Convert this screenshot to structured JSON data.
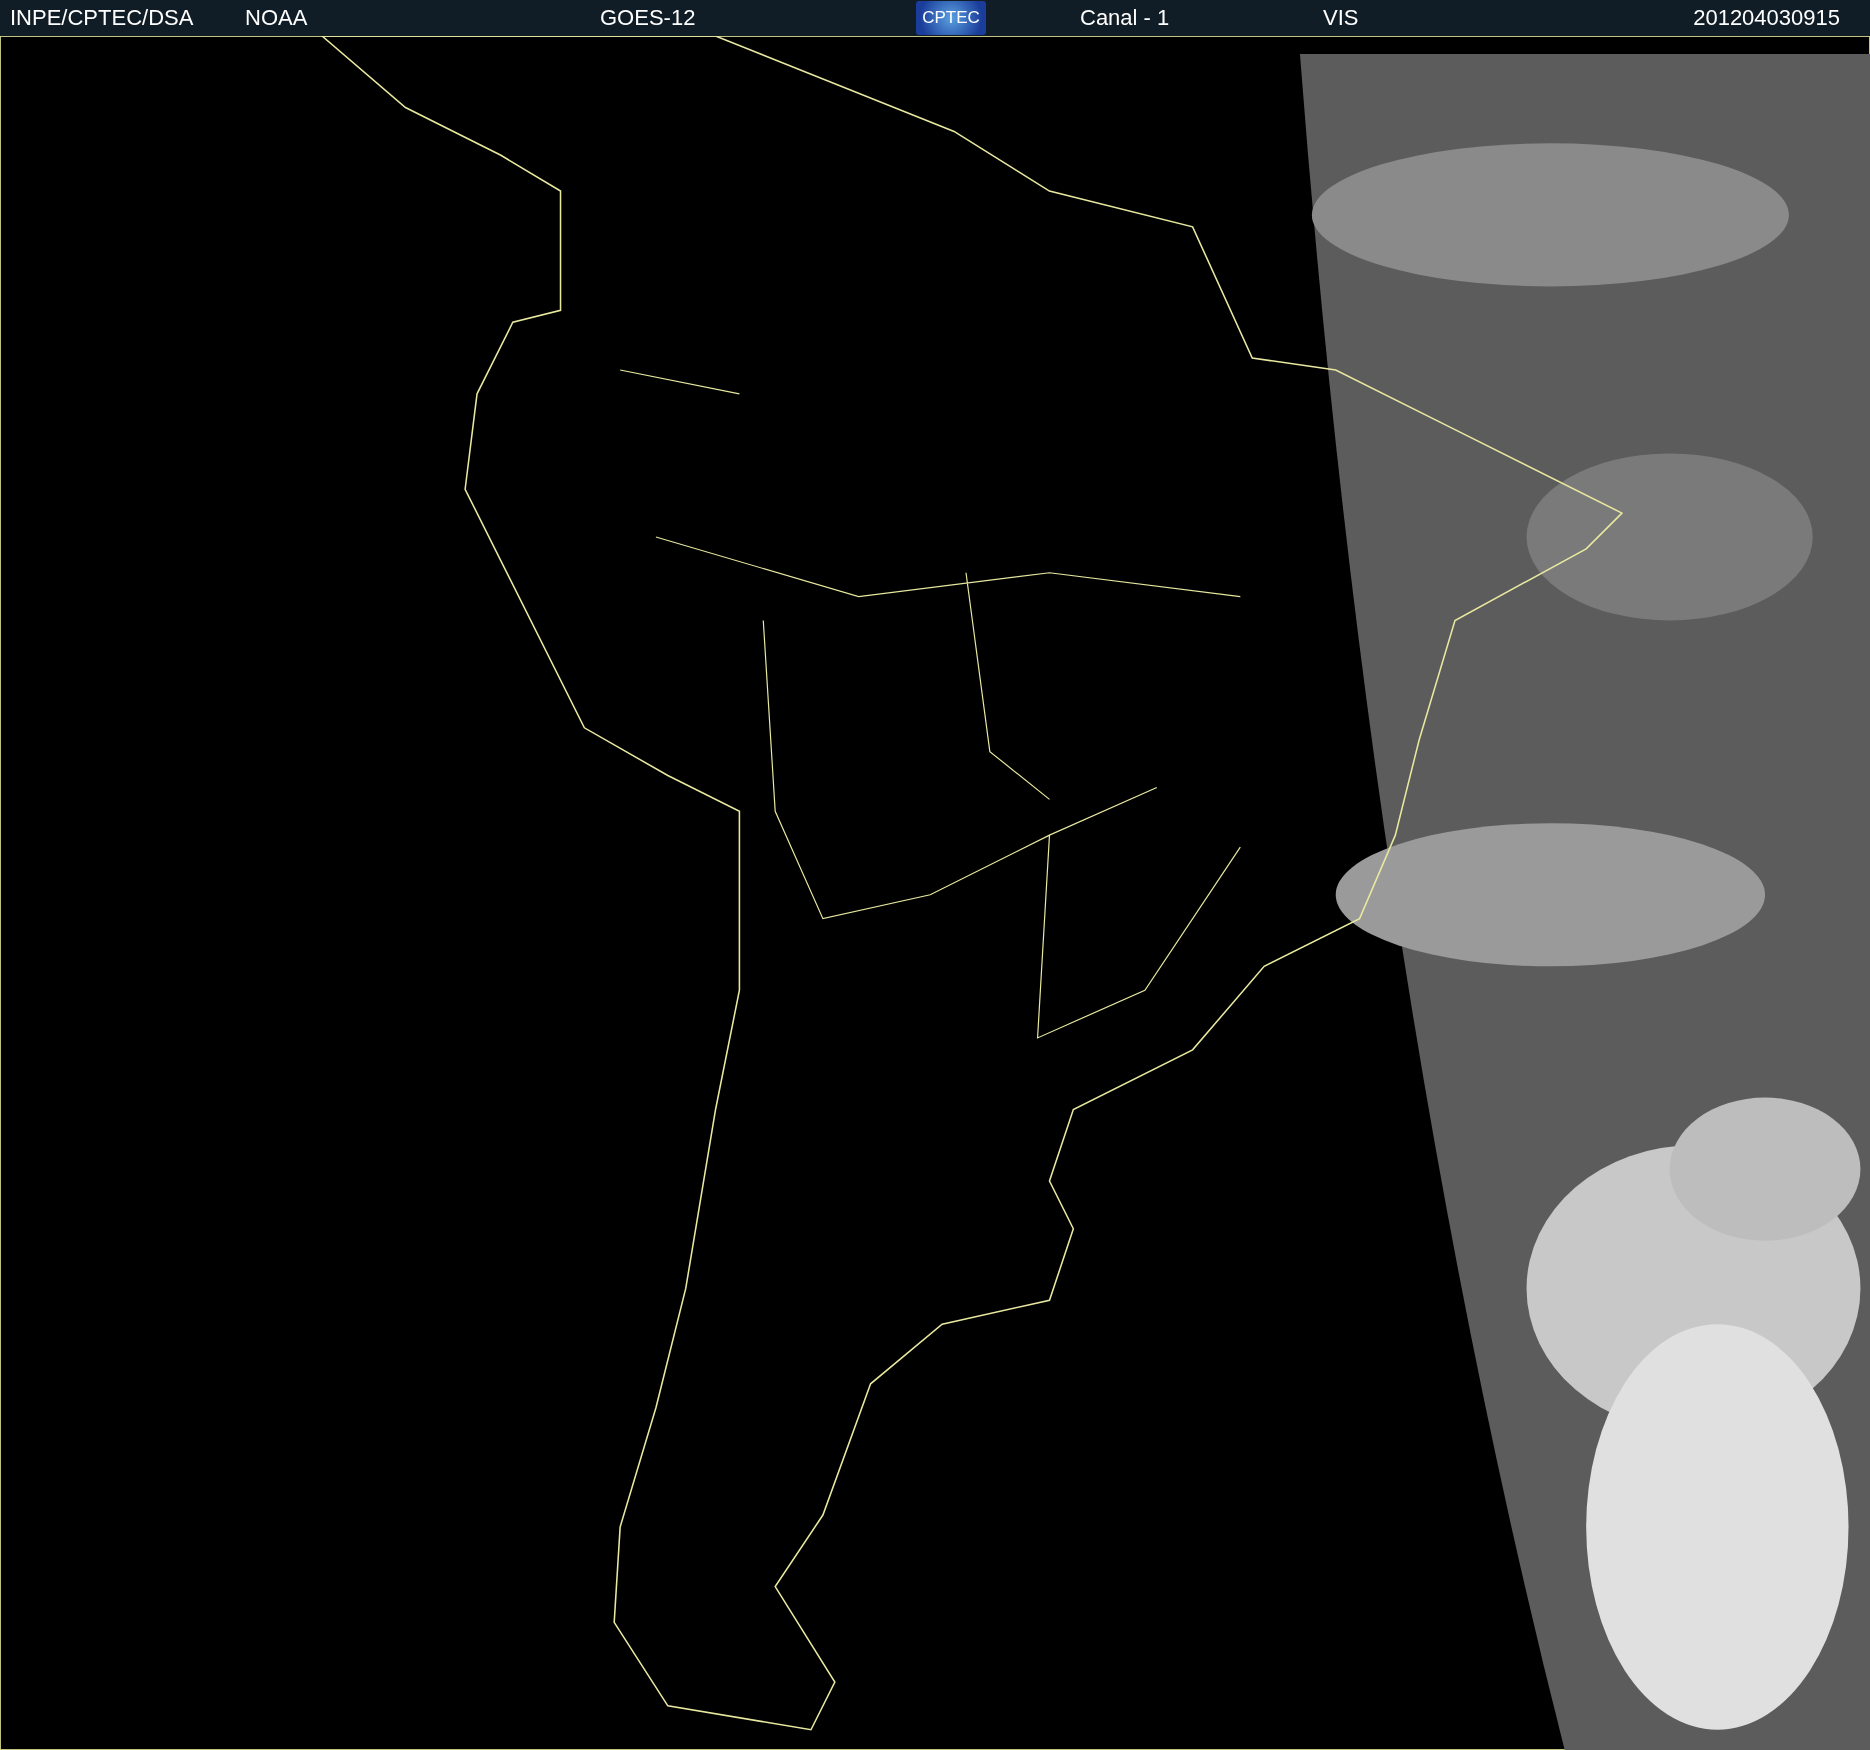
{
  "header": {
    "agency": "INPE/CPTEC/DSA",
    "operator": "NOAA",
    "satellite": "GOES-12",
    "logo": "CPTEC",
    "channel": "Canal - 1",
    "band": "VIS",
    "timestamp": "201204030915"
  }
}
